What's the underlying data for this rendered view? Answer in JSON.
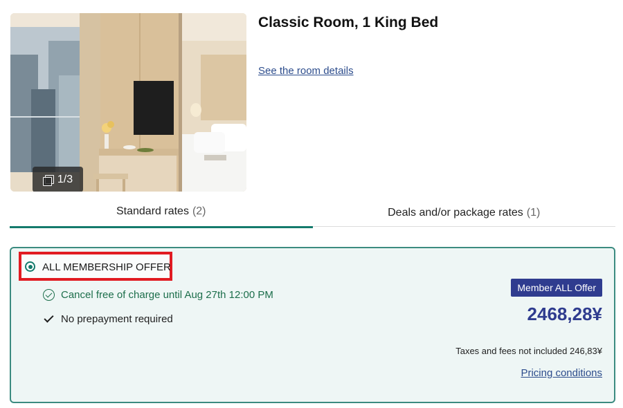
{
  "room": {
    "title": "Classic Room, 1 King Bed",
    "details_link": "See the room details",
    "photo_counter": "1/3"
  },
  "tabs": [
    {
      "label": "Standard rates",
      "count": "(2)",
      "active": true
    },
    {
      "label": "Deals and/or package rates",
      "count": "(1)",
      "active": false
    }
  ],
  "rate": {
    "name": "ALL MEMBERSHIP OFFER",
    "selected": true,
    "conditions": [
      {
        "icon": "circle-check-icon",
        "text": "Cancel free of charge until Aug 27th 12:00 PM"
      },
      {
        "icon": "check-icon",
        "text": "No prepayment required"
      }
    ],
    "badge": "Member ALL Offer",
    "price": "2468,28¥",
    "taxes": "Taxes and fees not included 246,83¥",
    "pricing_link": "Pricing conditions"
  },
  "colors": {
    "accent": "#137a6c",
    "brand": "#2f3c8f",
    "highlight": "#e11b22",
    "card_bg": "#eef6f5"
  }
}
